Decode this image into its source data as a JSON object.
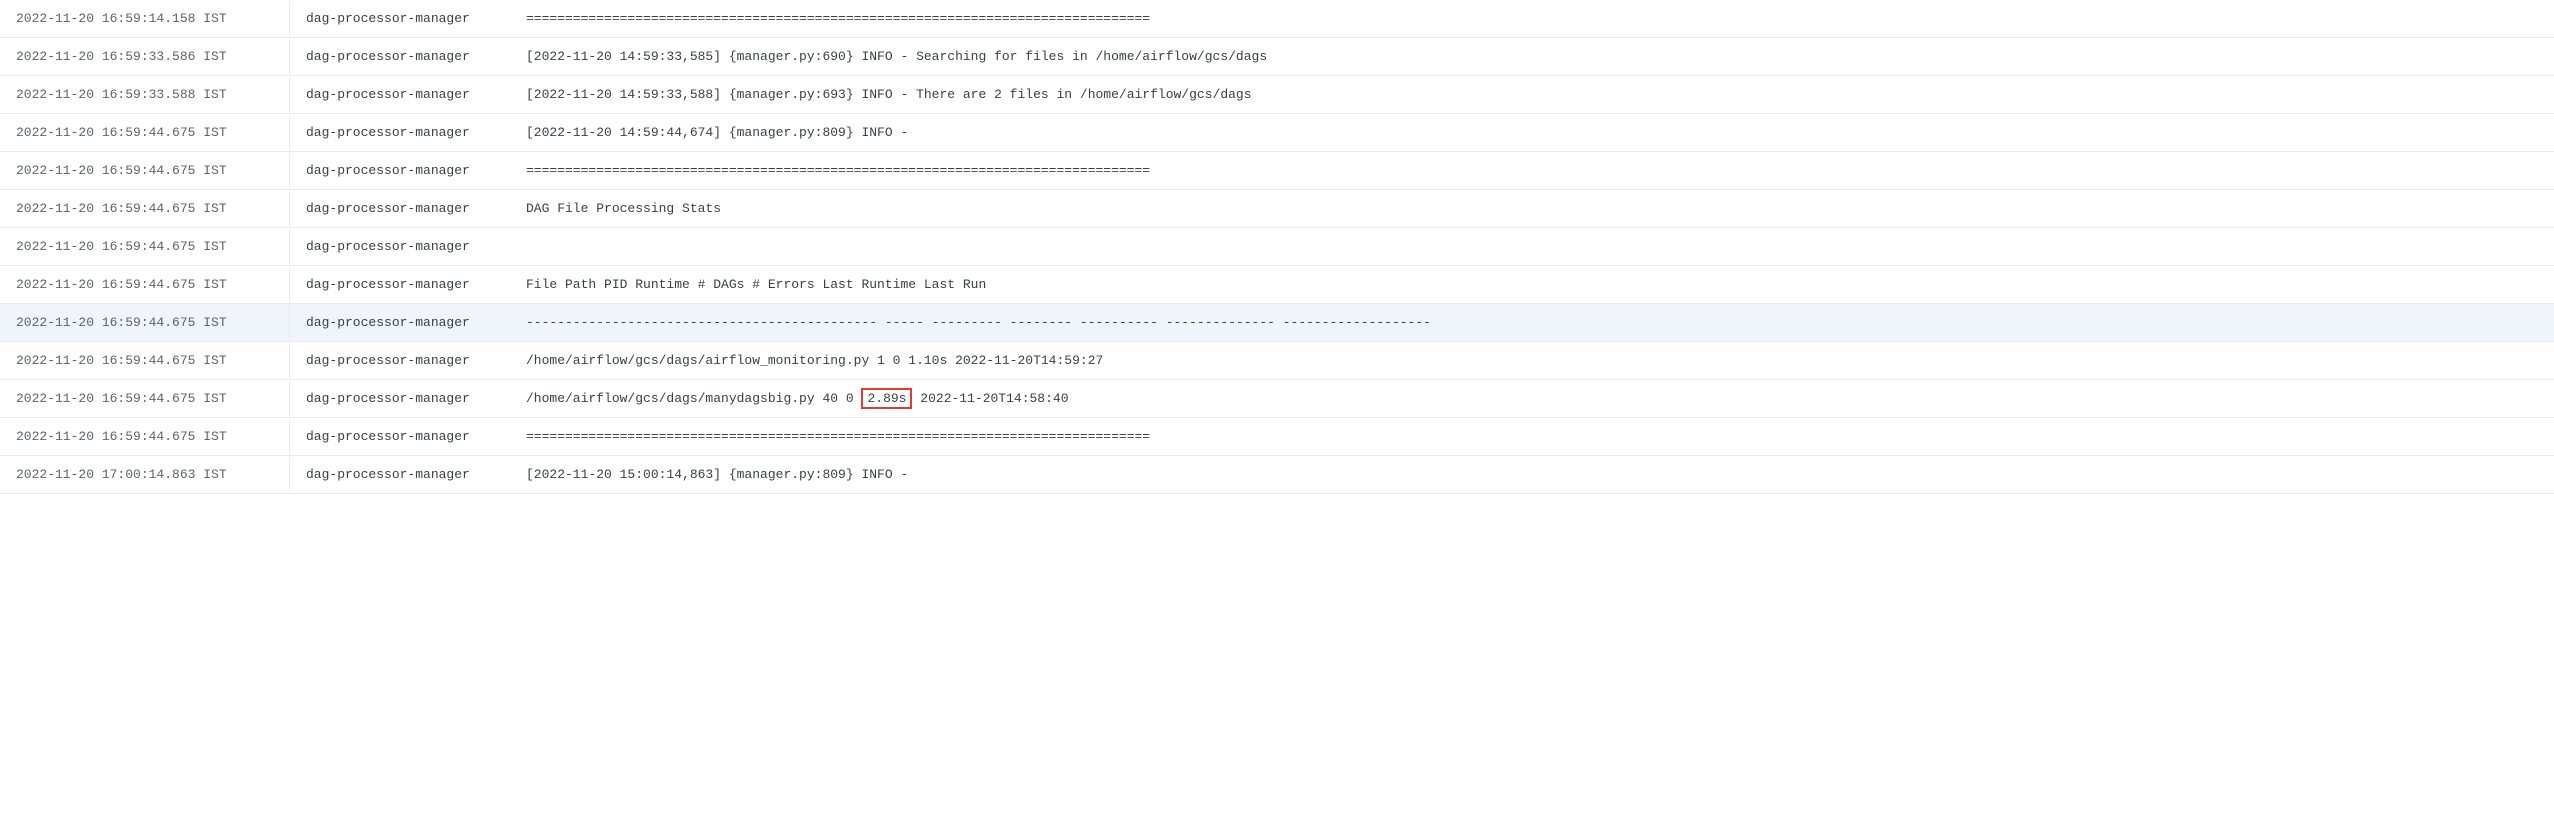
{
  "logs": [
    {
      "timestamp": "2022-11-20 16:59:14.158 IST",
      "component": "dag-processor-manager",
      "message": "================================================================================",
      "highlighted": false
    },
    {
      "timestamp": "2022-11-20 16:59:33.586 IST",
      "component": "dag-processor-manager",
      "message": "[2022-11-20 14:59:33,585] {manager.py:690} INFO - Searching for files in /home/airflow/gcs/dags",
      "highlighted": false
    },
    {
      "timestamp": "2022-11-20 16:59:33.588 IST",
      "component": "dag-processor-manager",
      "message": "[2022-11-20 14:59:33,588] {manager.py:693} INFO - There are 2 files in /home/airflow/gcs/dags",
      "highlighted": false
    },
    {
      "timestamp": "2022-11-20 16:59:44.675 IST",
      "component": "dag-processor-manager",
      "message": "[2022-11-20 14:59:44,674] {manager.py:809} INFO - ",
      "highlighted": false
    },
    {
      "timestamp": "2022-11-20 16:59:44.675 IST",
      "component": "dag-processor-manager",
      "message": "================================================================================",
      "highlighted": false
    },
    {
      "timestamp": "2022-11-20 16:59:44.675 IST",
      "component": "dag-processor-manager",
      "message": "DAG File Processing Stats",
      "highlighted": false
    },
    {
      "timestamp": "2022-11-20 16:59:44.675 IST",
      "component": "dag-processor-manager",
      "message": "",
      "highlighted": false
    },
    {
      "timestamp": "2022-11-20 16:59:44.675 IST",
      "component": "dag-processor-manager",
      "message": "File Path PID Runtime # DAGs # Errors Last Runtime Last Run",
      "highlighted": false
    },
    {
      "timestamp": "2022-11-20 16:59:44.675 IST",
      "component": "dag-processor-manager",
      "message": "--------------------------------------------- ----- --------- -------- ---------- -------------- -------------------",
      "highlighted": true
    },
    {
      "timestamp": "2022-11-20 16:59:44.675 IST",
      "component": "dag-processor-manager",
      "message_before": "/home/airflow/gcs/dags/airflow_monitoring.py 1 0 1.10s 2022-11-20T14:59:27",
      "highlighted": false
    },
    {
      "timestamp": "2022-11-20 16:59:44.675 IST",
      "component": "dag-processor-manager",
      "message_before": "/home/airflow/gcs/dags/manydagsbig.py 40 0 ",
      "message_highlight": "2.89s",
      "message_after": " 2022-11-20T14:58:40",
      "highlighted": false,
      "has_box": true
    },
    {
      "timestamp": "2022-11-20 16:59:44.675 IST",
      "component": "dag-processor-manager",
      "message": "================================================================================",
      "highlighted": false
    },
    {
      "timestamp": "2022-11-20 17:00:14.863 IST",
      "component": "dag-processor-manager",
      "message": "[2022-11-20 15:00:14,863] {manager.py:809} INFO - ",
      "highlighted": false
    }
  ]
}
